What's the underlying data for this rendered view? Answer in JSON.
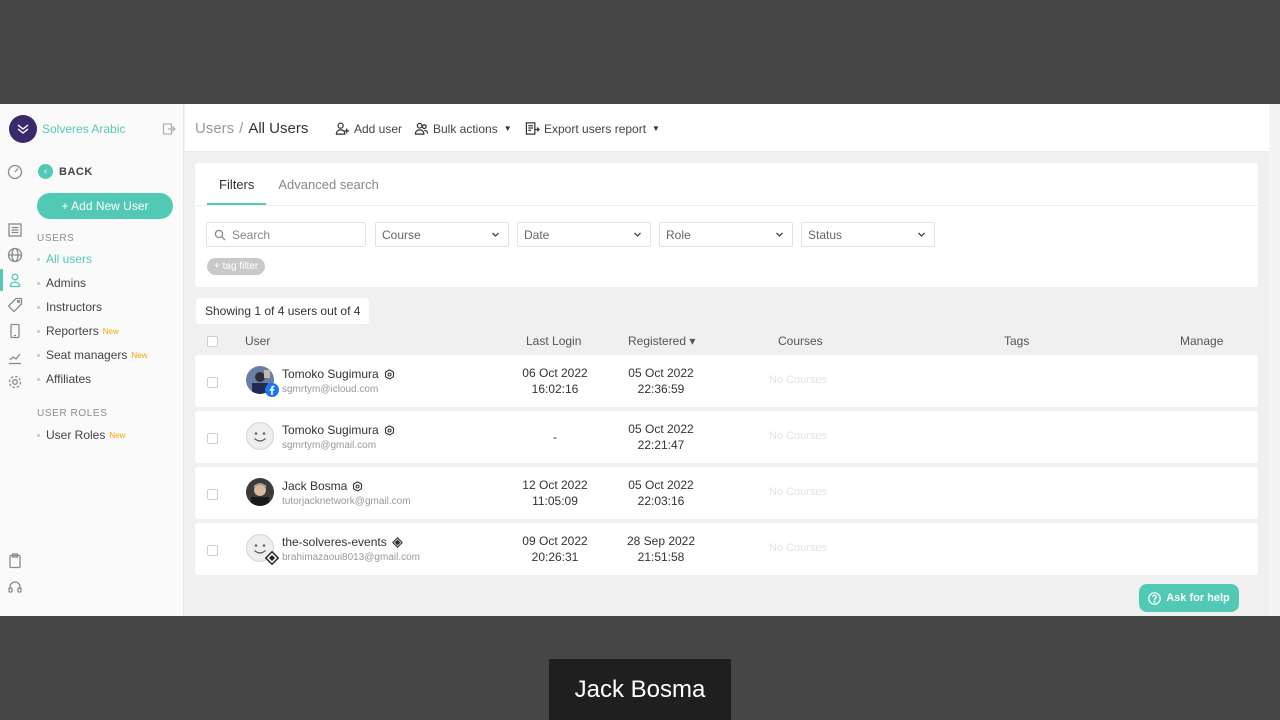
{
  "colors": {
    "accent": "#52c9b4",
    "brand_logo": "#3a2a6c",
    "new_badge": "#f0a800"
  },
  "brand": {
    "name": "Solveres Arabic"
  },
  "sidebar": {
    "back_label": "BACK",
    "add_new_user_label": "+ Add New User",
    "users_section_title": "USERS",
    "items": [
      {
        "label": "All users",
        "badge": ""
      },
      {
        "label": "Admins",
        "badge": ""
      },
      {
        "label": "Instructors",
        "badge": ""
      },
      {
        "label": "Reporters",
        "badge": "New"
      },
      {
        "label": "Seat managers",
        "badge": "New"
      },
      {
        "label": "Affiliates",
        "badge": ""
      }
    ],
    "roles_section_title": "USER ROLES",
    "role_items": [
      {
        "label": "User Roles",
        "badge": "New"
      }
    ]
  },
  "header": {
    "breadcrumb_parent": "Users",
    "breadcrumb_sep": "/",
    "breadcrumb_current": "All Users",
    "add_user_label": "Add user",
    "bulk_actions_label": "Bulk actions",
    "export_label": "Export users report"
  },
  "filters": {
    "tabs": [
      "Filters",
      "Advanced search"
    ],
    "search_placeholder": "Search",
    "selects": [
      "Course",
      "Date",
      "Role",
      "Status"
    ],
    "tag_filter_label": "+ tag filter"
  },
  "table": {
    "showing_text": "Showing 1 of 4 users out of 4",
    "columns": {
      "user": "User",
      "last_login": "Last Login",
      "registered": "Registered ▾",
      "courses": "Courses",
      "tags": "Tags",
      "manage": "Manage"
    },
    "rows": [
      {
        "name": "Tomoko Sugimura",
        "email": "sgmrtym@icloud.com",
        "last_login_date": "06 Oct 2022",
        "last_login_time": "16:02:16",
        "registered_date": "05 Oct 2022",
        "registered_time": "22:36:59",
        "courses": "No Courses",
        "avatar": "photo-avatar",
        "badge": "facebook-icon"
      },
      {
        "name": "Tomoko Sugimura",
        "email": "sgmrtym@gmail.com",
        "last_login_date": "-",
        "last_login_time": "",
        "registered_date": "05 Oct 2022",
        "registered_time": "22:21:47",
        "courses": "No Courses",
        "avatar": "smiley-avatar",
        "badge": ""
      },
      {
        "name": "Jack Bosma",
        "email": "tutorjacknetwork@gmail.com",
        "last_login_date": "12 Oct 2022",
        "last_login_time": "11:05:09",
        "registered_date": "05 Oct 2022",
        "registered_time": "22:03:16",
        "courses": "No Courses",
        "avatar": "photo-avatar",
        "badge": ""
      },
      {
        "name": "the-solveres-events",
        "email": "brahimazaoui8013@gmail.com",
        "last_login_date": "09 Oct 2022",
        "last_login_time": "20:26:31",
        "registered_date": "28 Sep 2022",
        "registered_time": "21:51:58",
        "courses": "No Courses",
        "avatar": "smiley-avatar",
        "badge": "diamond-icon"
      }
    ]
  },
  "help_button_label": "Ask for help",
  "caption": "Jack Bosma"
}
